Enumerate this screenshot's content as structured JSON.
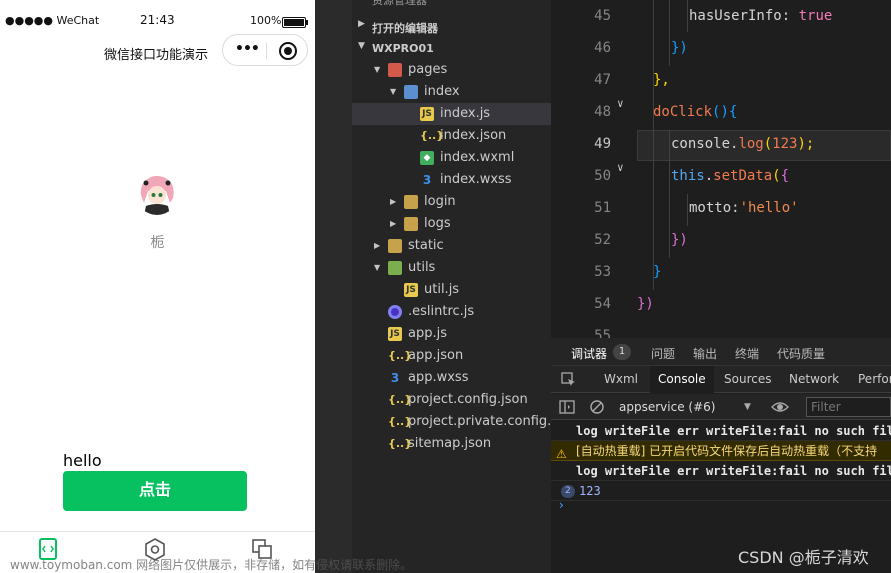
{
  "simulator": {
    "status_bar": {
      "carrier": "●●●●● WeChat",
      "time": "21:43",
      "battery": "100%"
    },
    "nav": {
      "title": "微信接口功能演示",
      "capsule_more": "•••"
    },
    "user": {
      "nickname": "栀"
    },
    "motto": "hello",
    "click_button": "点击",
    "tabbar": {
      "icons": [
        "code-tab-icon",
        "hexagon-tab-icon",
        "pages-tab-icon"
      ]
    }
  },
  "explorer": {
    "header_cut": "资源管理器",
    "open_editors": "打开的编辑器",
    "project": "WXPRO01",
    "items": [
      {
        "label": "pages",
        "kind": "folder-red",
        "depth": 1,
        "expanded": true
      },
      {
        "label": "index",
        "kind": "folder-blue",
        "depth": 2,
        "expanded": true
      },
      {
        "label": "index.js",
        "kind": "js",
        "depth": 3,
        "selected": true,
        "icon_text": "JS"
      },
      {
        "label": "index.json",
        "kind": "json",
        "depth": 3,
        "icon_text": "{..}"
      },
      {
        "label": "index.wxml",
        "kind": "wxml",
        "depth": 3,
        "icon_text": "◆"
      },
      {
        "label": "index.wxss",
        "kind": "wxss",
        "depth": 3,
        "icon_text": "3"
      },
      {
        "label": "login",
        "kind": "folder",
        "depth": 2,
        "expanded": false
      },
      {
        "label": "logs",
        "kind": "folder",
        "depth": 2,
        "expanded": false
      },
      {
        "label": "static",
        "kind": "folder",
        "depth": 1,
        "expanded": false
      },
      {
        "label": "utils",
        "kind": "folder-green",
        "depth": 1,
        "expanded": true
      },
      {
        "label": "util.js",
        "kind": "js",
        "depth": 2,
        "icon_text": "JS"
      },
      {
        "label": ".eslintrc.js",
        "kind": "eslint",
        "depth": 1,
        "icon_text": ""
      },
      {
        "label": "app.js",
        "kind": "js",
        "depth": 1,
        "icon_text": "JS"
      },
      {
        "label": "app.json",
        "kind": "json",
        "depth": 1,
        "icon_text": "{..}"
      },
      {
        "label": "app.wxss",
        "kind": "wxss",
        "depth": 1,
        "icon_text": "3"
      },
      {
        "label": "project.config.json",
        "kind": "json",
        "depth": 1,
        "icon_text": "{..}"
      },
      {
        "label": "project.private.config.js...",
        "kind": "json",
        "depth": 1,
        "icon_text": "{..}"
      },
      {
        "label": "sitemap.json",
        "kind": "json",
        "depth": 1,
        "icon_text": "{..}"
      }
    ]
  },
  "editor": {
    "line_numbers": [
      "45",
      "46",
      "47",
      "48",
      "49",
      "50",
      "51",
      "52",
      "53",
      "54",
      "55"
    ],
    "current_line": "49",
    "code": {
      "l45_key": "hasUserInfo:",
      "l45_val": "true",
      "l46": "})",
      "l47": "},",
      "l48_fn": "doClick",
      "l48_paren": "()",
      "l48_brace": "{",
      "l49_obj": "console.",
      "l49_fn": "log",
      "l49_open": "(",
      "l49_num": "123",
      "l49_close": ");",
      "l50_this": "this",
      "l50_dot": ".",
      "l50_fn": "setData",
      "l50_open": "(",
      "l50_brace": "{",
      "l51_key": "motto:",
      "l51_str": "'hello'",
      "l52": "})",
      "l53": "}",
      "l54": "})"
    }
  },
  "debugger": {
    "top_tabs": [
      "调试器",
      "问题",
      "输出",
      "终端",
      "代码质量"
    ],
    "debugger_badge": "1",
    "panel_tabs": [
      "Wxml",
      "Console",
      "Sources",
      "Network",
      "Perfor"
    ],
    "active_panel": "Console",
    "context": "appservice (#6)",
    "filter_placeholder": "Filter",
    "logs": [
      "log writeFile err writeFile:fail no such file or",
      "[自动热重载] 已开启代码文件保存后自动热重载（不支持",
      "log writeFile err writeFile:fail no such file or"
    ],
    "repeat_count": "2",
    "log_value": "123",
    "prompt": "›"
  },
  "watermarks": {
    "bottom": "www.toymoban.com 网络图片仅供展示，非存储，如有侵权请联系删除。",
    "csdn": "CSDN @栀子清欢"
  }
}
